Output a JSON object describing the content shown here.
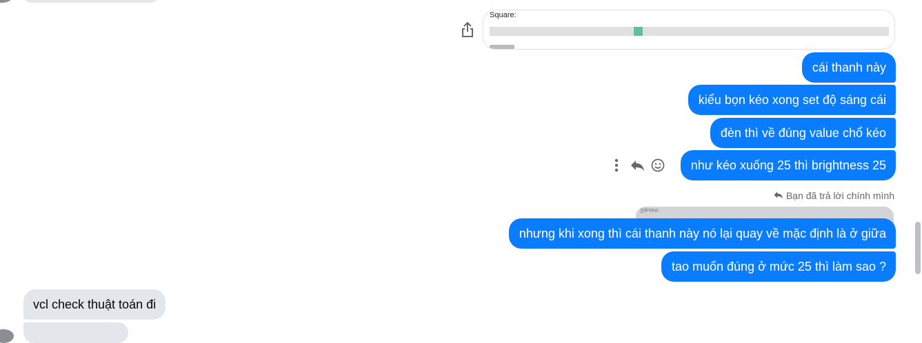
{
  "colors": {
    "outgoing_bubble": "#0a7cff",
    "incoming_bubble": "#e4e6eb",
    "slider_thumb": "#58c596"
  },
  "preview": {
    "label": "Square:",
    "slider_value_fraction": 0.37
  },
  "messages_out": [
    "cái thanh này",
    "kiểu bọn kéo xong set độ sáng cái",
    "đèn thì về đúng value chổ kéo",
    "như kéo xuống 25 thì brightness 25",
    "nhưng khi xong thì cái thanh này nó lại quay về mặc định là ở giữa",
    "tao muốn đúng ở mức  25 thì làm sao ?"
  ],
  "reply_notice": "Bạn đã trả lời chính mình",
  "reply_quote_label": "Square:",
  "messages_in": [
    "vcl check thuật toán đi"
  ],
  "icons": {
    "share": "share-icon",
    "more": "more-options-icon",
    "reply": "reply-icon",
    "react": "smiley-icon"
  }
}
